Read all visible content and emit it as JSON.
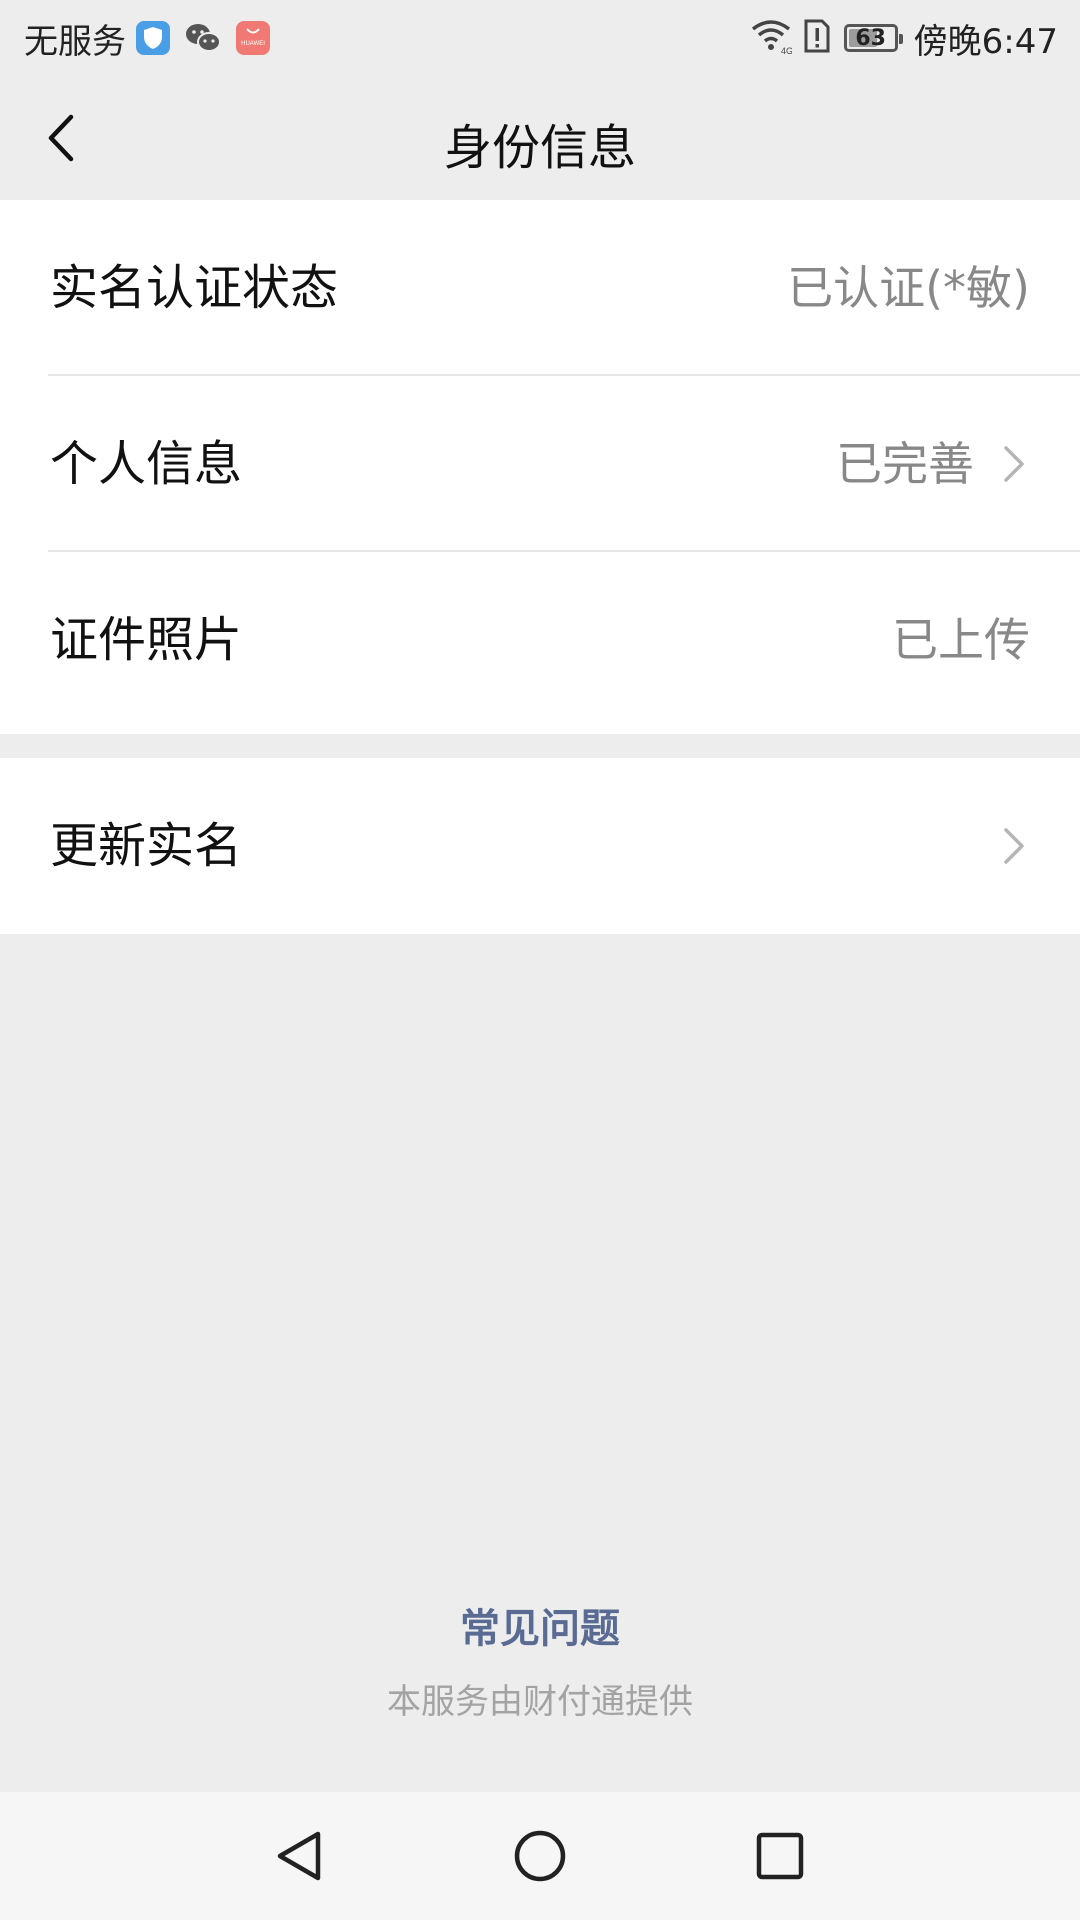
{
  "status_bar": {
    "carrier": "无服务",
    "huawei_badge": "HUAWEI",
    "battery": "63",
    "battery_level": 0.63,
    "time": "傍晚6:47",
    "network": "4G"
  },
  "nav": {
    "title": "身份信息"
  },
  "group1": {
    "rows": [
      {
        "label": "实名认证状态",
        "value": "已认证(*敏)"
      },
      {
        "label": "个人信息",
        "value": "已完善"
      },
      {
        "label": "证件照片",
        "value": "已上传"
      }
    ]
  },
  "group2": {
    "rows": [
      {
        "label": "更新实名"
      }
    ]
  },
  "footer": {
    "faq": "常见问题",
    "provider": "本服务由财付通提供"
  },
  "colors": {
    "background": "#ededed",
    "card": "#ffffff",
    "link": "#5a6b93",
    "secondary_text": "#888888"
  },
  "icons": [
    "shield-app-icon",
    "wechat-icon",
    "huawei-app-icon",
    "wifi-icon",
    "sim-alert-icon",
    "battery-icon",
    "back-arrow-icon",
    "chevron-right-icon",
    "triangle-back-icon",
    "circle-home-icon",
    "square-recent-icon"
  ]
}
